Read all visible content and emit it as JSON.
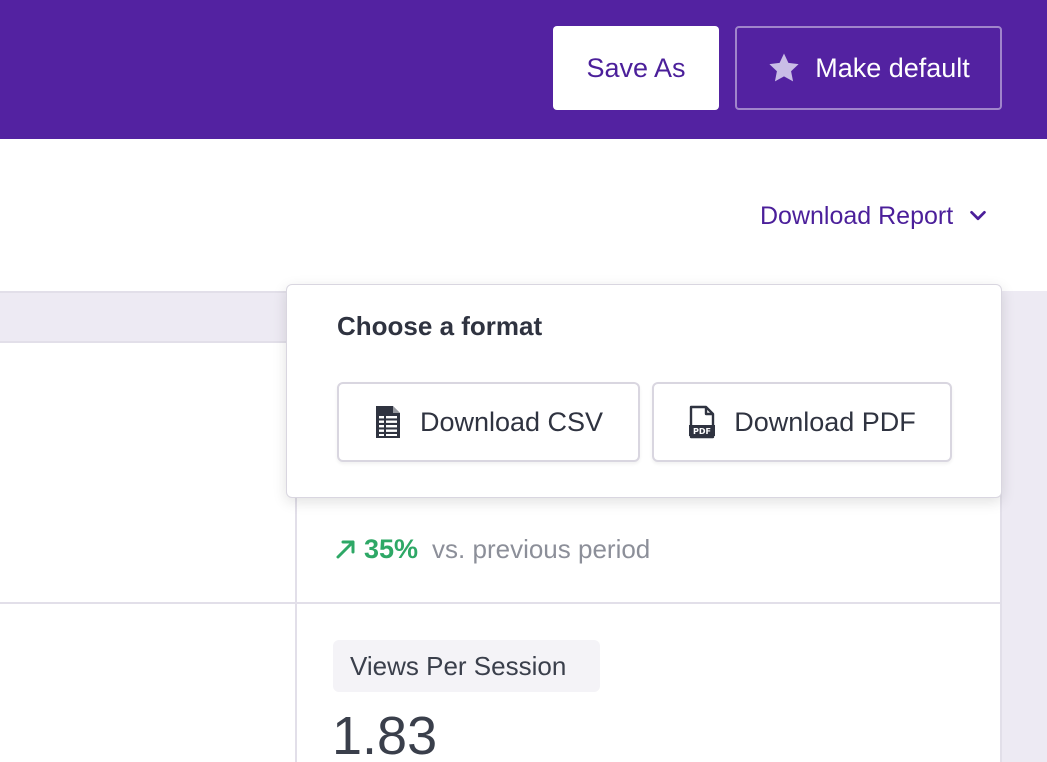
{
  "header": {
    "save_as_label": "Save As",
    "make_default_label": "Make default",
    "background_color": "#5322a1"
  },
  "download_report": {
    "label": "Download Report"
  },
  "format_menu": {
    "title": "Choose a format",
    "csv_label": "Download CSV",
    "pdf_label": "Download PDF",
    "pdf_icon_text": "PDF"
  },
  "metrics": {
    "trend_percent": "35%",
    "trend_text": "vs. previous period",
    "trend_color": "#2ea866",
    "views_per_session_label": "Views Per Session",
    "views_per_session_value": "1.83"
  },
  "icons": {
    "make_default": "star-icon",
    "download_report": "chevron-down-icon",
    "csv": "spreadsheet-file-icon",
    "pdf": "pdf-file-icon",
    "trend": "arrow-up-right-icon"
  }
}
